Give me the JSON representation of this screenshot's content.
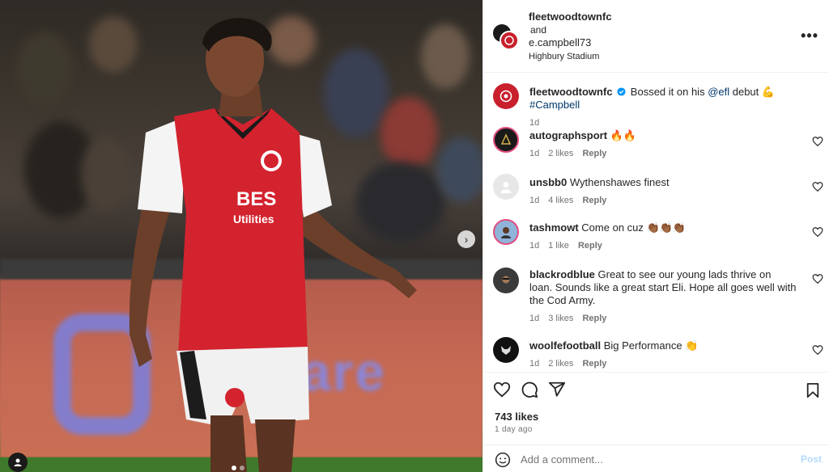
{
  "media": {
    "next_icon": "chevron-right-icon",
    "tag_icon": "user-tag-icon",
    "jersey_sponsor": "BES\nUtilities",
    "board_text": "nCare"
  },
  "header": {
    "user1": "fleetwoodtownfc",
    "joiner": "and",
    "user2": "e.campbell73",
    "location": "Highbury Stadium",
    "more_icon": "more-options-icon",
    "more_glyph": "•••"
  },
  "caption": {
    "user": "fleetwoodtownfc",
    "verified_icon": "verified-badge-icon",
    "text_before": "Bossed it on his ",
    "mention": "@efl",
    "text_after": " debut 💪 ",
    "hashtag": "#Campbell",
    "time": "1d"
  },
  "comments": [
    {
      "user": "autographsport",
      "text": "🔥🔥",
      "time": "1d",
      "likes": "2 likes",
      "reply": "Reply"
    },
    {
      "user": "unsbb0",
      "text": "Wythenshawes finest",
      "time": "1d",
      "likes": "4 likes",
      "reply": "Reply"
    },
    {
      "user": "tashmowt",
      "text": "Come on cuz 👏🏾👏🏾👏🏾",
      "time": "1d",
      "likes": "1 like",
      "reply": "Reply"
    },
    {
      "user": "blackrodblue",
      "text": "Great to see our young lads thrive on loan. Sounds like a great start Eli. Hope all goes well with the Cod Army.",
      "time": "1d",
      "likes": "3 likes",
      "reply": "Reply"
    },
    {
      "user": "woolfefootball",
      "text": "Big Performance 👏",
      "time": "1d",
      "likes": "2 likes",
      "reply": "Reply"
    }
  ],
  "actions": {
    "like_icon": "heart-icon",
    "comment_icon": "comment-icon",
    "share_icon": "share-icon",
    "save_icon": "bookmark-icon",
    "likes": "743 likes",
    "time_ago": "1 day ago"
  },
  "add_comment": {
    "emoji_icon": "emoji-icon",
    "placeholder": "Add a comment...",
    "post_label": "Post"
  },
  "colors": {
    "link": "#00376b",
    "verified": "#0095f6",
    "post_disabled": "#b3dbff",
    "jersey_red": "#d3232f"
  }
}
